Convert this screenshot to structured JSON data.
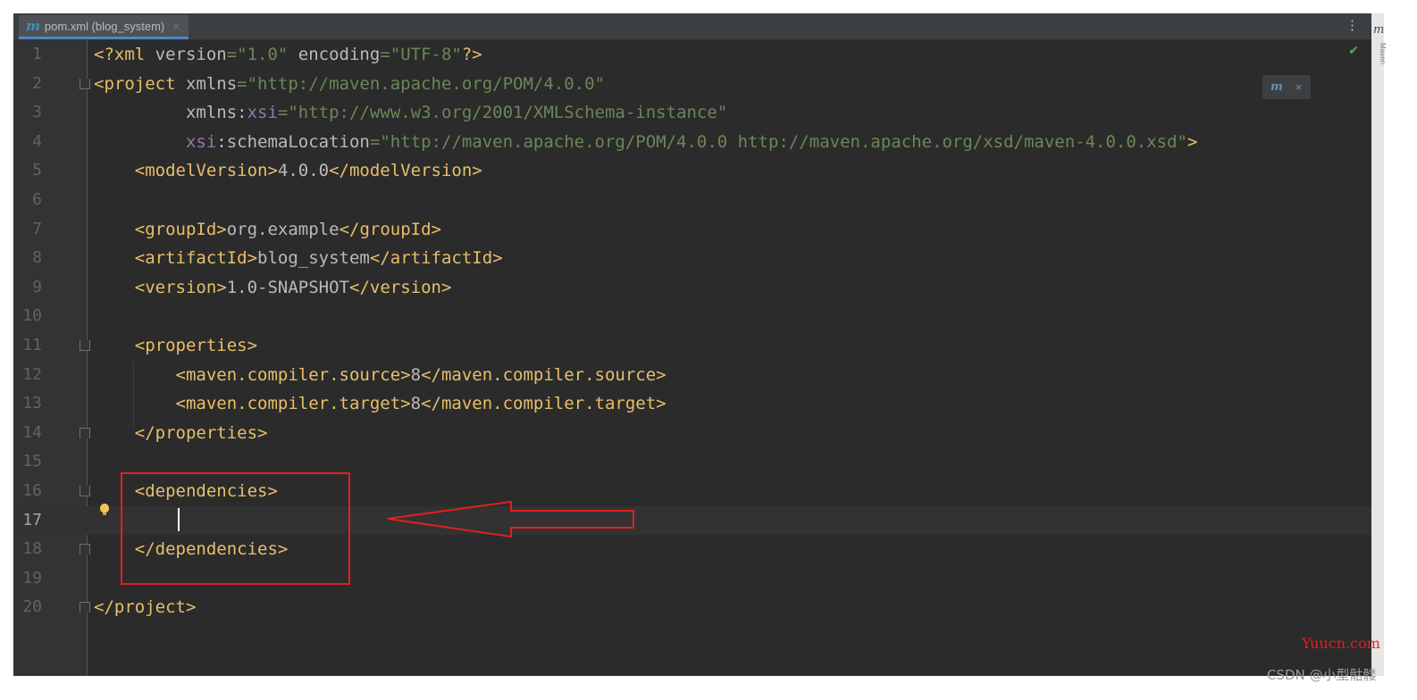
{
  "tab": {
    "icon": "maven-m-icon",
    "title": "pom.xml (blog_system)",
    "close": "×"
  },
  "toolbar": {
    "more_icon": "⋮",
    "check_icon": "✔",
    "maven_badge_m": "m",
    "maven_badge_close": "×"
  },
  "editor": {
    "current_line": 17,
    "lines": [
      {
        "n": "1",
        "tokens": [
          [
            "t",
            "<?xml "
          ],
          [
            "a",
            "version"
          ],
          [
            "v",
            "=\"1.0\""
          ],
          [
            "a",
            " encoding"
          ],
          [
            "v",
            "=\"UTF-8\""
          ],
          [
            "t",
            "?>"
          ]
        ]
      },
      {
        "n": "2",
        "tokens": [
          [
            "t",
            "<project "
          ],
          [
            "a",
            "xmlns"
          ],
          [
            "v",
            "=\"http://maven.apache.org/POM/4.0.0\""
          ]
        ]
      },
      {
        "n": "3",
        "tokens": [
          [
            "a",
            "         xmlns:"
          ],
          [
            "ns",
            "xsi"
          ],
          [
            "v",
            "=\"http://www.w3.org/2001/XMLSchema-instance\""
          ]
        ]
      },
      {
        "n": "4",
        "tokens": [
          [
            "ns",
            "         xsi"
          ],
          [
            "a",
            ":schemaLocation"
          ],
          [
            "v",
            "=\"http://maven.apache.org/POM/4.0.0 http://maven.apache.org/xsd/maven-4.0.0.xsd\""
          ],
          [
            "t",
            ">"
          ]
        ]
      },
      {
        "n": "5",
        "tokens": [
          [
            "t",
            "    <modelVersion>"
          ],
          [
            "a",
            "4.0.0"
          ],
          [
            "t",
            "</modelVersion>"
          ]
        ]
      },
      {
        "n": "6",
        "tokens": []
      },
      {
        "n": "7",
        "tokens": [
          [
            "t",
            "    <groupId>"
          ],
          [
            "a",
            "org.example"
          ],
          [
            "t",
            "</groupId>"
          ]
        ]
      },
      {
        "n": "8",
        "tokens": [
          [
            "t",
            "    <artifactId>"
          ],
          [
            "a",
            "blog_system"
          ],
          [
            "t",
            "</artifactId>"
          ]
        ]
      },
      {
        "n": "9",
        "tokens": [
          [
            "t",
            "    <version>"
          ],
          [
            "a",
            "1.0-SNAPSHOT"
          ],
          [
            "t",
            "</version>"
          ]
        ]
      },
      {
        "n": "10",
        "tokens": []
      },
      {
        "n": "11",
        "tokens": [
          [
            "t",
            "    <properties>"
          ]
        ]
      },
      {
        "n": "12",
        "tokens": [
          [
            "t",
            "        <maven.compiler.source>"
          ],
          [
            "a",
            "8"
          ],
          [
            "t",
            "</maven.compiler.source>"
          ]
        ]
      },
      {
        "n": "13",
        "tokens": [
          [
            "t",
            "        <maven.compiler.target>"
          ],
          [
            "a",
            "8"
          ],
          [
            "t",
            "</maven.compiler.target>"
          ]
        ]
      },
      {
        "n": "14",
        "tokens": [
          [
            "t",
            "    </properties>"
          ]
        ]
      },
      {
        "n": "15",
        "tokens": []
      },
      {
        "n": "16",
        "tokens": [
          [
            "t",
            "    <dependencies>"
          ]
        ]
      },
      {
        "n": "17",
        "tokens": []
      },
      {
        "n": "18",
        "tokens": [
          [
            "t",
            "    </dependencies>"
          ]
        ]
      },
      {
        "n": "19",
        "tokens": []
      },
      {
        "n": "20",
        "tokens": [
          [
            "t",
            "</project>"
          ]
        ]
      }
    ],
    "fold_open_lines": [
      2,
      11,
      16
    ],
    "fold_close_lines": [
      14,
      18,
      20
    ]
  },
  "sidebar": {
    "m": "m",
    "label": "Maven"
  },
  "annotation": {
    "color": "#e02020",
    "shapes": [
      "rectangle around dependencies block",
      "arrow pointing to line 17"
    ]
  },
  "watermarks": {
    "site": "Yuucn.com",
    "author": "CSDN @小型骷髅"
  }
}
